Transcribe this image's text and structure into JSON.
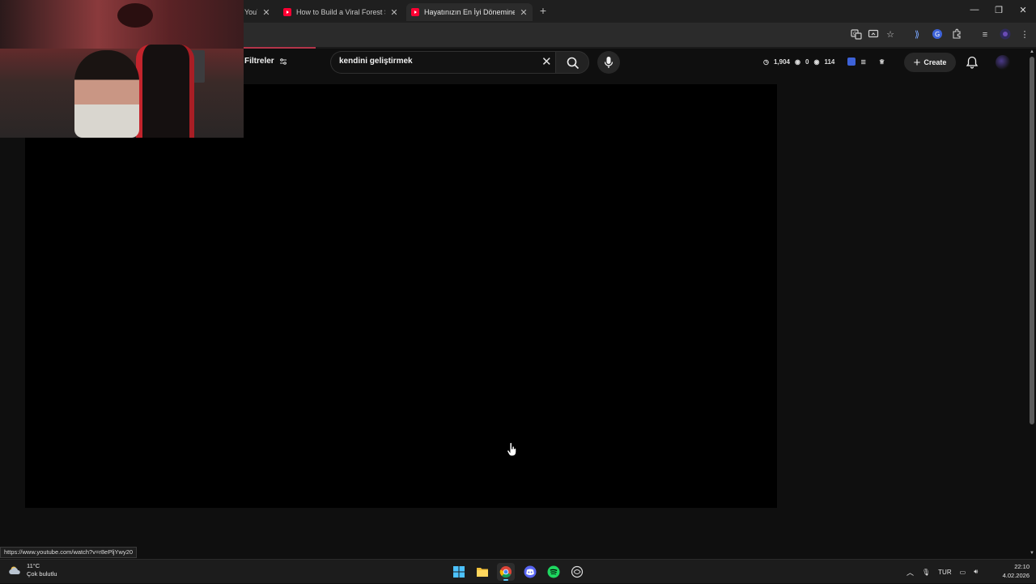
{
  "browser": {
    "tabs": [
      {
        "title": "YouT",
        "active": false
      },
      {
        "title": "How to Build a Viral Forest Surv",
        "active": false
      },
      {
        "title": "Hayatınızın En İyi Dönemine Gir",
        "active": true
      }
    ],
    "status_url": "https://www.youtube.com/watch?v=r8ePljYwy20"
  },
  "youtube": {
    "filters_label": "Filtreler",
    "search_value": "kendini geliştirmek",
    "stats": {
      "time": "1,904",
      "eye1": "0",
      "eye2": "114"
    },
    "create_label": "Create"
  },
  "taskbar": {
    "weather_temp": "11°C",
    "weather_desc": "Çok bulutlu",
    "language": "TUR",
    "time": "22:10",
    "date": "4.02.2026"
  },
  "colors": {
    "brand": "#ff0033",
    "accent": "#60cdff",
    "spotify": "#1ed760",
    "discord": "#5865f2"
  },
  "icons": [
    "translate-icon",
    "cast-icon",
    "star-icon",
    "extensions-icon",
    "reading-list-icon",
    "search-icon",
    "mic-icon",
    "bell-icon",
    "windows-icon",
    "folder-icon",
    "chrome-icon",
    "discord-icon",
    "spotify-icon"
  ]
}
